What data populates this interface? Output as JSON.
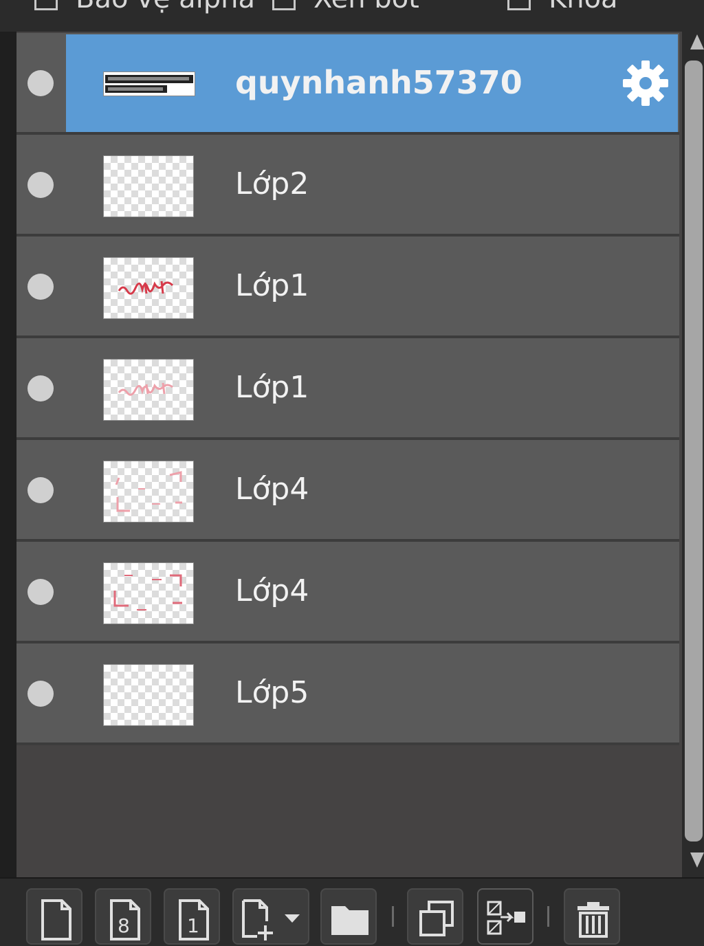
{
  "options": {
    "alpha_protect": "Bảo vệ alpha",
    "clip": "Xén bớt",
    "lock": "Khóa"
  },
  "layers": [
    {
      "name": "quynhanh57370",
      "active": true
    },
    {
      "name": "Lớp2",
      "active": false
    },
    {
      "name": "Lớp1",
      "active": false
    },
    {
      "name": "Lớp1",
      "active": false
    },
    {
      "name": "Lớp4",
      "active": false
    },
    {
      "name": "Lớp4",
      "active": false
    },
    {
      "name": "Lớp5",
      "active": false
    }
  ],
  "toolbar": {
    "icons": [
      "new-layer-icon",
      "new-8bit-layer-icon",
      "new-1bit-layer-icon",
      "new-special-layer-icon",
      "new-folder-icon",
      "duplicate-layer-icon",
      "merge-layer-icon",
      "delete-layer-icon"
    ]
  },
  "colors": {
    "selection": "#5b9bd5",
    "layer_bg": "#5a5a5a",
    "panel_bg": "#454343"
  }
}
